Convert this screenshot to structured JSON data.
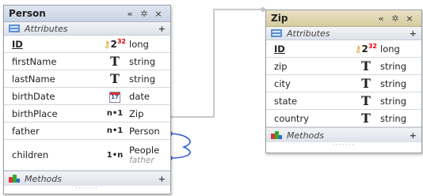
{
  "person": {
    "title": "Person",
    "attributes_label": "Attributes",
    "methods_label": "Methods",
    "rows": [
      {
        "name": "ID",
        "icon_text": "2",
        "icon_sup": "32",
        "type": "long"
      },
      {
        "name": "firstName",
        "icon_text": "T",
        "type": "string"
      },
      {
        "name": "lastName",
        "icon_text": "T",
        "type": "string"
      },
      {
        "name": "birthDate",
        "icon_text": "17",
        "type": "date"
      },
      {
        "name": "birthPlace",
        "icon_text": "n•1",
        "type": "Zip"
      },
      {
        "name": "father",
        "icon_text": "n•1",
        "type": "Person"
      },
      {
        "name": "children",
        "icon_text": "1•n",
        "type": "People",
        "type_sub": "father"
      }
    ]
  },
  "zip": {
    "title": "Zip",
    "attributes_label": "Attributes",
    "methods_label": "Methods",
    "rows": [
      {
        "name": "ID",
        "icon_text": "2",
        "icon_sup": "32",
        "type": "long"
      },
      {
        "name": "zip",
        "icon_text": "T",
        "type": "string"
      },
      {
        "name": "city",
        "icon_text": "T",
        "type": "string"
      },
      {
        "name": "state",
        "icon_text": "T",
        "type": "string"
      },
      {
        "name": "country",
        "icon_text": "T",
        "type": "string"
      }
    ]
  },
  "toolbar": {
    "collapse": "«",
    "settings": "✲",
    "close": "×",
    "add": "+",
    "dots": "·······"
  }
}
